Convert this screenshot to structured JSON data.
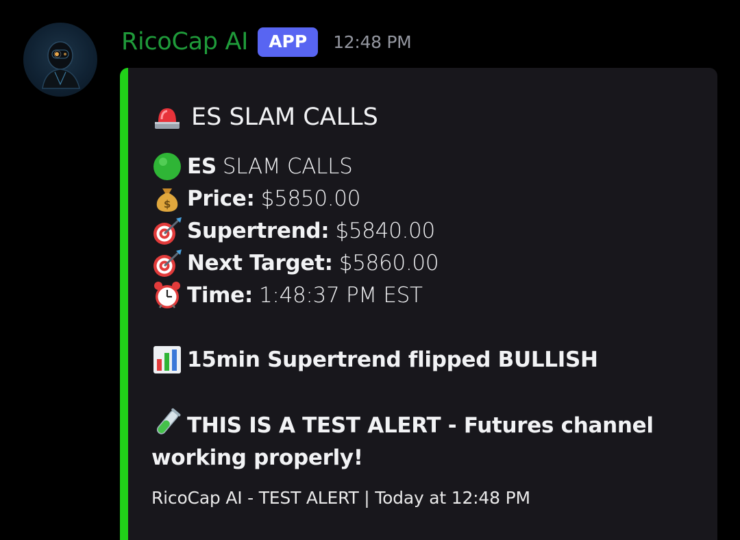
{
  "author": {
    "name": "RicoCap AI",
    "badge": "APP",
    "time": "12:48 PM",
    "avatar_icon": "robot-avatar-icon",
    "name_color": "#1f9b3a"
  },
  "embed": {
    "accent_color": "#21d119",
    "title_icon": "rotating-light-icon",
    "title": "ES SLAM CALLS",
    "fields": [
      {
        "icon": "green-circle-icon",
        "label": "ES",
        "value": "SLAM CALLS"
      },
      {
        "icon": "money-bag-icon",
        "label": "Price:",
        "value": "$5850.00"
      },
      {
        "icon": "direct-hit-icon",
        "label": "Supertrend:",
        "value": "$5840.00"
      },
      {
        "icon": "direct-hit-icon",
        "label": "Next Target:",
        "value": "$5860.00"
      },
      {
        "icon": "alarm-clock-icon",
        "label": "Time:",
        "value": "1:48:37 PM EST"
      }
    ],
    "signal": {
      "icon": "bar-chart-icon",
      "text": "15min Supertrend flipped BULLISH"
    },
    "test_alert": {
      "icon": "test-tube-icon",
      "text": "THIS IS A TEST ALERT - Futures channel working properly!"
    },
    "footer": "RicoCap AI - TEST ALERT | Today at 12:48 PM"
  }
}
